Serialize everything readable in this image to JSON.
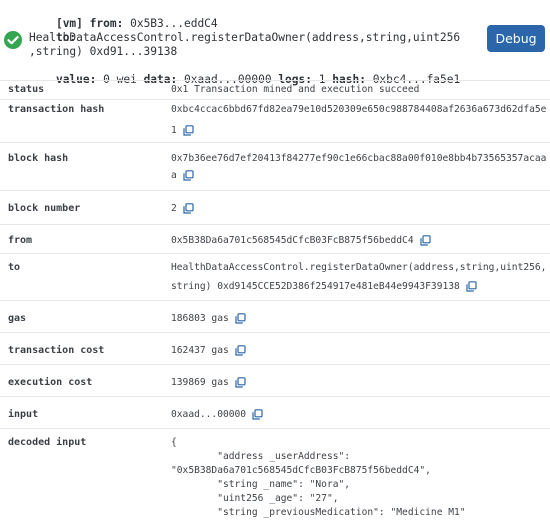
{
  "header": {
    "vm_tag": "[vm]",
    "from_label": "from:",
    "from_value": "0x5B3...eddC4",
    "to_label": "to:",
    "to_line1": "HealthDataAccessControl.registerDataOwner(address,string,uint256",
    "to_line2": ",string) 0xd91...39138",
    "value_label": "value:",
    "value_value": "0 wei",
    "data_label": "data:",
    "data_value": "0xaad...00000",
    "logs_label": "logs:",
    "logs_value": "1",
    "hash_label": "hash:",
    "hash_value": "0xbc4...fa5e1",
    "debug_label": "Debug"
  },
  "rows": {
    "status": {
      "label": "status",
      "value": "0x1 Transaction mined and execution succeed"
    },
    "transaction_hash": {
      "label": "transaction hash",
      "value_line1": "0xbc4ccac6bbd67fd82ea79e10d520309e650c988784408af2636a673d62dfa5e",
      "value_line2": "1"
    },
    "block_hash": {
      "label": "block hash",
      "value_line1": "0x7b36ee76d7ef20413f84277ef90c1e66cbac88a00f010e8bb4b73565357acaa",
      "value_line2": "a"
    },
    "block_number": {
      "label": "block number",
      "value": "2"
    },
    "from": {
      "label": "from",
      "value": "0x5B38Da6a701c568545dCfcB03FcB875f56beddC4"
    },
    "to": {
      "label": "to",
      "value_line1": "HealthDataAccessControl.registerDataOwner(address,string,uint256,",
      "value_line2": "string) 0xd9145CCE52D386f254917e481eB44e9943F39138"
    },
    "gas": {
      "label": "gas",
      "value": "186803 gas"
    },
    "transaction_cost": {
      "label": "transaction cost",
      "value": "162437 gas"
    },
    "execution_cost": {
      "label": "execution cost",
      "value": "139869 gas"
    },
    "input": {
      "label": "input",
      "value": "0xaad...00000"
    },
    "decoded_input": {
      "label": "decoded input",
      "lines": [
        "{",
        "        \"address _userAddress\":",
        "\"0x5B38Da6a701c568545dCfcB03FcB875f56beddC4\",",
        "        \"string _name\": \"Nora\",",
        "        \"uint256 _age\": \"27\",",
        "        \"string _previousMedication\": \"Medicine M1\""
      ]
    }
  },
  "icons": {
    "success": "check-circle-icon",
    "copy": "copy-icon"
  },
  "colors": {
    "success_green": "#35a552",
    "debug_button": "#2b66aa",
    "copy_icon": "#2b66aa"
  }
}
